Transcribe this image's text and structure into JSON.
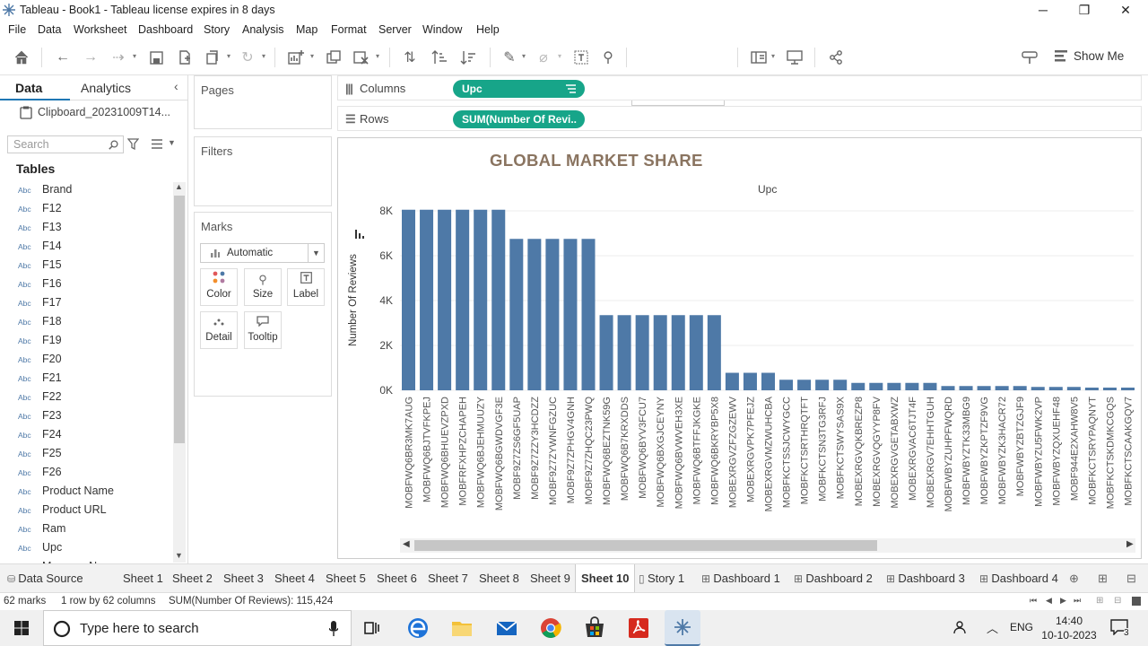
{
  "window": {
    "title": "Tableau - Book1 - Tableau license expires in 8 days",
    "controls": [
      "minimize-icon",
      "restore-icon",
      "close-icon"
    ]
  },
  "menu": [
    "File",
    "Data",
    "Worksheet",
    "Dashboard",
    "Story",
    "Analysis",
    "Map",
    "Format",
    "Server",
    "Window",
    "Help"
  ],
  "toolbar": {
    "fit_select": "Standard",
    "show_me_label": "Show Me"
  },
  "left_panel": {
    "tabs": [
      "Data",
      "Analytics"
    ],
    "datasource": "Clipboard_20231009T14...",
    "search_placeholder": "Search",
    "tables_header": "Tables",
    "field_type": "Abc",
    "fields": [
      "Brand",
      "F12",
      "F13",
      "F14",
      "F15",
      "F16",
      "F17",
      "F18",
      "F19",
      "F20",
      "F21",
      "F22",
      "F23",
      "F24",
      "F25",
      "F26",
      "Product Name",
      "Product URL",
      "Ram",
      "Upc"
    ],
    "cut_field": "Measure Names"
  },
  "cards": {
    "pages": "Pages",
    "filters": "Filters",
    "marks": "Marks",
    "mark_type": "Automatic",
    "mark_buttons": [
      "Color",
      "Size",
      "Label",
      "Detail",
      "Tooltip"
    ]
  },
  "shelves": {
    "columns_label": "Columns",
    "columns_pill": "Upc",
    "rows_label": "Rows",
    "rows_pill": "SUM(Number Of Revi.."
  },
  "chart_data": {
    "type": "bar",
    "title": "GLOBAL MARKET SHARE",
    "xlabel": "Upc",
    "ylabel": "Number Of Reviews",
    "yticks": [
      "8K",
      "6K",
      "4K",
      "2K",
      "0K"
    ],
    "ylim": [
      0,
      8000
    ],
    "categories": [
      "MOBFWQ6BR3MK7AUG",
      "MOBFWQ6BJTVFKPEJ",
      "MOBFWQ6BHUEVZPXD",
      "MOBFRFXHPZCHAPEH",
      "MOBFWQ6BJEHMUUZY",
      "MOBFWQ6BGWDVGF3E",
      "MOBF9Z7ZS6GF5UAP",
      "MOBF9Z7ZZY3HCDZZ",
      "MOBF9Z7ZYWNFGZUC",
      "MOBF9Z7ZPHGV4GNH",
      "MOBF9Z7ZHQC23PWQ",
      "MOBFWQ6BEZTNK59G",
      "MOBFWQ6B7KRXDDS",
      "MOBFWQ6BYV3FCU7",
      "MOBFWQ6BXGJCEYNY",
      "MOBFWQ6BVWVEH3XE",
      "MOBFWQ6BTFFJKGKE",
      "MOBFWQ6BKRYBP5X8",
      "MOBEXRGVZFZGZEWV",
      "MOBEXRGVPK7PFEJZ",
      "MOBEXRGVMZWUHCBA",
      "MOBFKCTSSJCWYGCC",
      "MOBFKCTSRTHRQTFT",
      "MOBFKCTSN3TG3RFJ",
      "MOBFKCTSWYSAS9X",
      "MOBEXRGVQKBREZP8",
      "MOBEXRGVQGYYP8FV",
      "MOBEXRGVGETABXWZ",
      "MOBEXRGVAC6TJT4F",
      "MOBEXRGV7EHHTGUH",
      "MOBFWBYZUHPFWQRD",
      "MOBFWBYZTK33MBG9",
      "MOBFWBYZKPTZF9VG",
      "MOBFWBYZK3HACR72",
      "MOBFWBYZBTZGJF9",
      "MOBFWBYZU5FWK2VP",
      "MOBFWBYZQXUEHF48",
      "MOBF944E2XAHW8V5",
      "MOBFKCTSRYPAQNYT",
      "MOBFKCTSKDMKCGQS",
      "MOBFKCTSCAAKGQV7"
    ],
    "values": [
      8050,
      8050,
      8050,
      8050,
      8050,
      8050,
      6750,
      6750,
      6750,
      6750,
      6750,
      3350,
      3350,
      3350,
      3350,
      3350,
      3350,
      3350,
      780,
      780,
      780,
      470,
      470,
      470,
      470,
      330,
      330,
      330,
      330,
      330,
      190,
      190,
      190,
      190,
      190,
      150,
      150,
      150,
      120,
      120,
      120
    ],
    "color": "#4e79a7",
    "grid": true,
    "legend": "none"
  },
  "sheet_tabs": [
    "Data Source",
    "Sheet 1",
    "Sheet 2",
    "Sheet 3",
    "Sheet 4",
    "Sheet 5",
    "Sheet 6",
    "Sheet 7",
    "Sheet 8",
    "Sheet 9",
    "Sheet 10",
    "Story 1",
    "Dashboard 1",
    "Dashboard 2",
    "Dashboard 3",
    "Dashboard 4"
  ],
  "active_tab": "Sheet 10",
  "status": {
    "marks": "62 marks",
    "dims": "1 row by 62 columns",
    "sum": "SUM(Number Of Reviews): 115,424"
  },
  "taskbar": {
    "search_placeholder": "Type here to search",
    "lang": "ENG",
    "time": "14:40",
    "date": "10-10-2023",
    "notifications": "3"
  }
}
